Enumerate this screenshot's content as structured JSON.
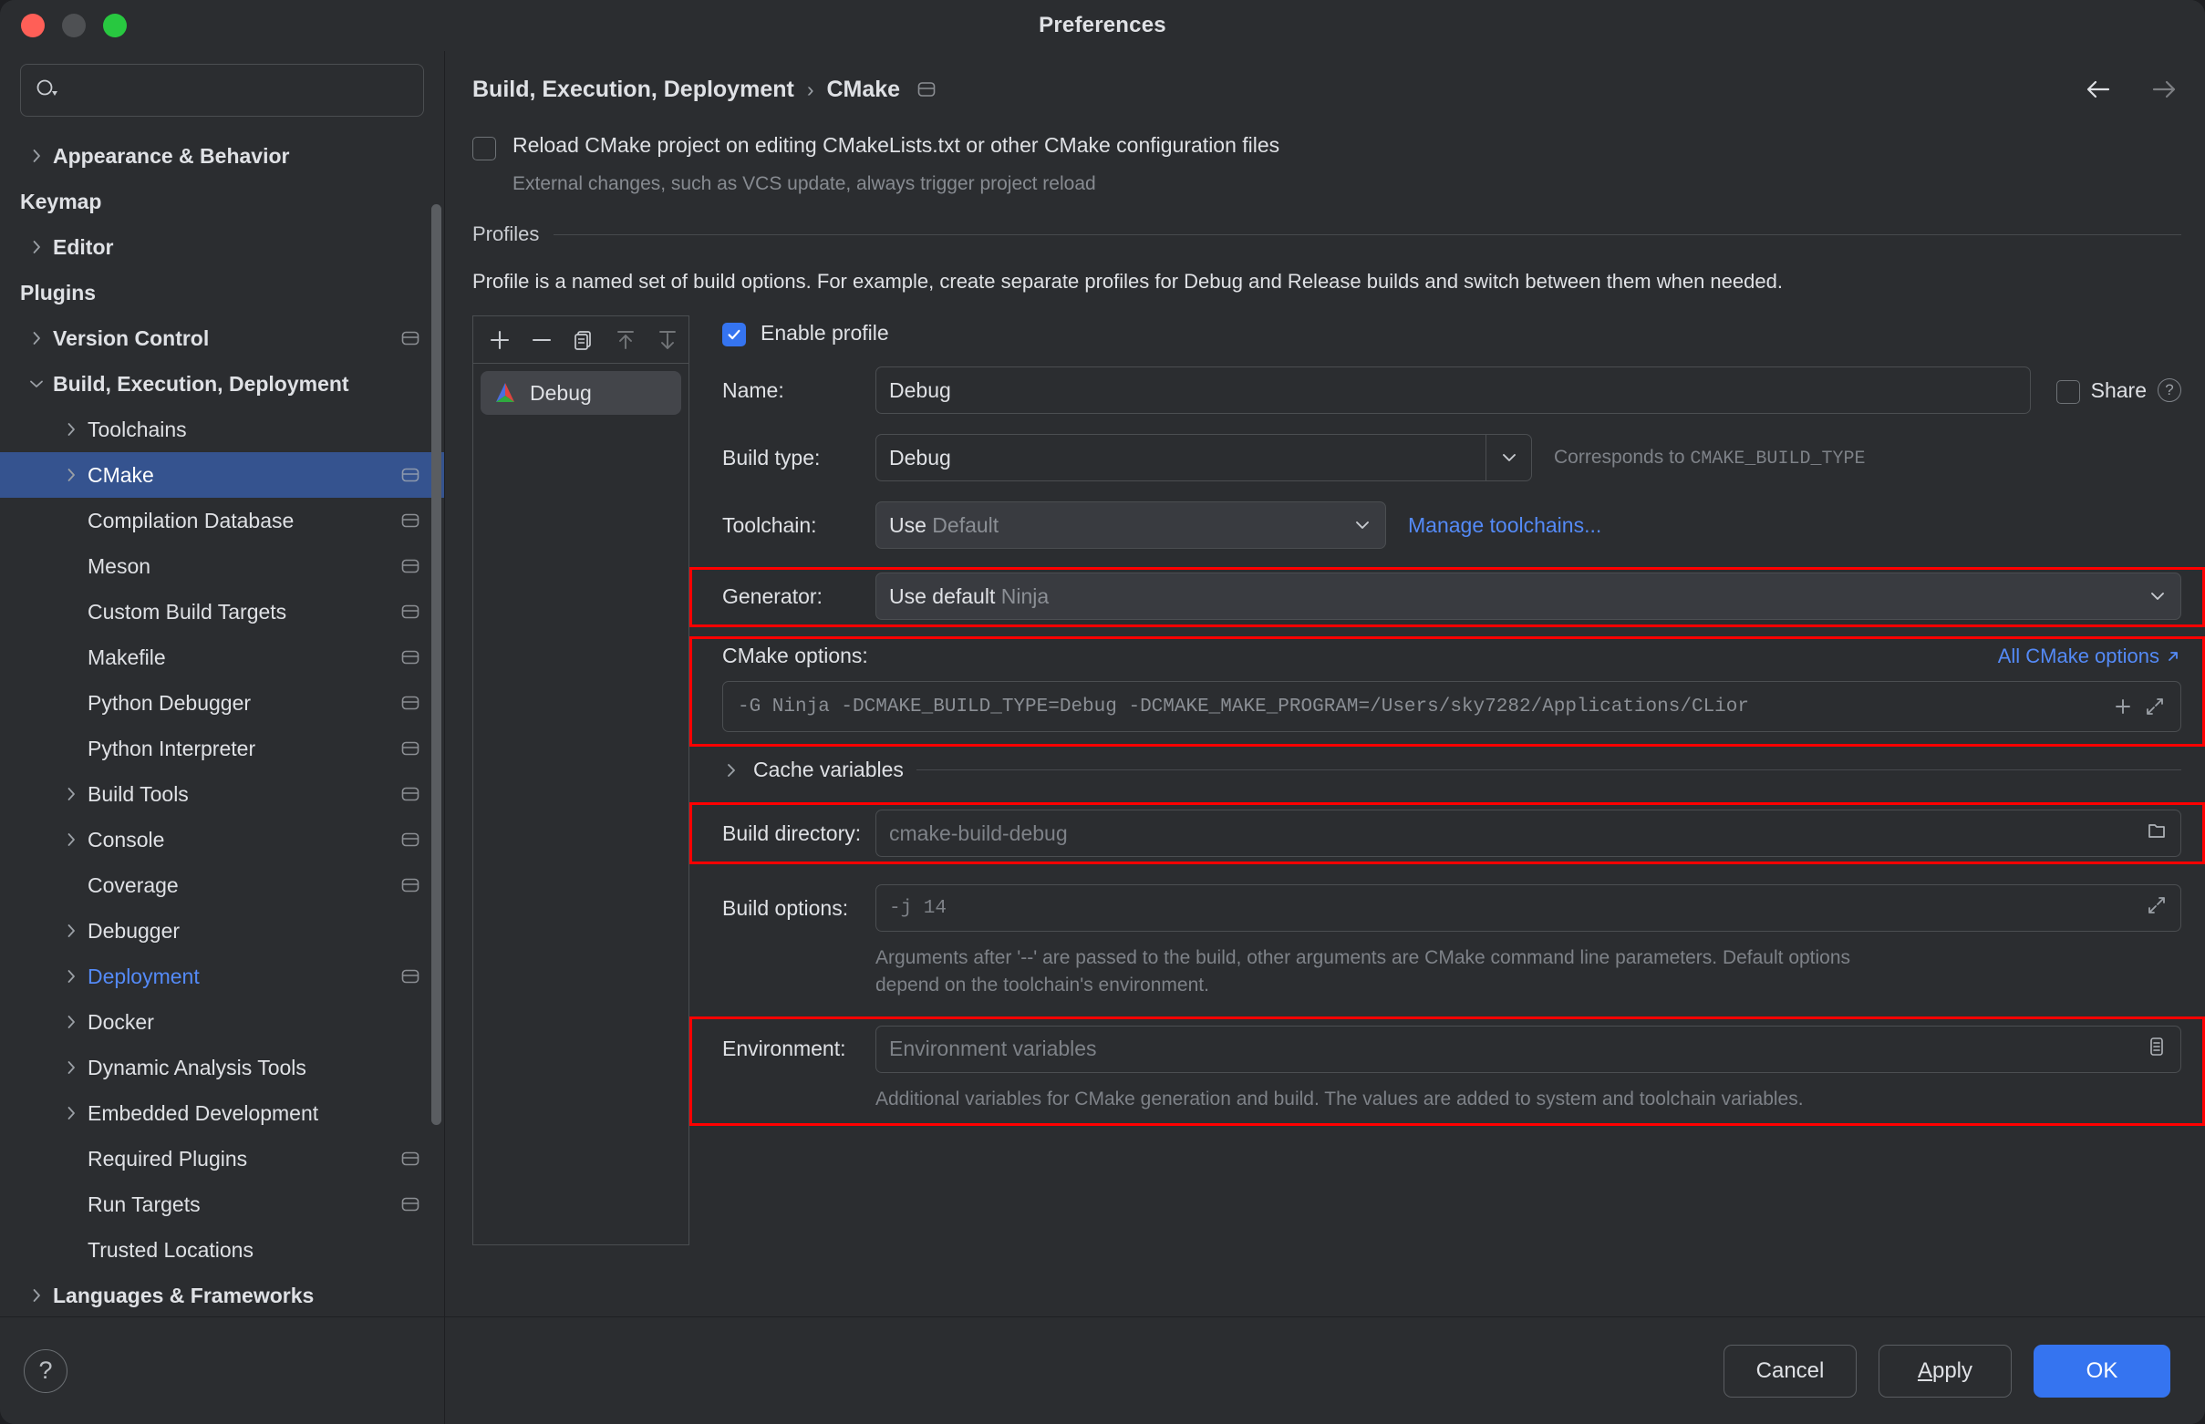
{
  "window": {
    "title": "Preferences"
  },
  "search": {
    "placeholder": "",
    "value": "",
    "icon": "search-icon"
  },
  "sidebar": {
    "items": [
      {
        "label": "Appearance & Behavior",
        "level": 0,
        "arrow": "right",
        "bold": true,
        "project_icon": false,
        "selected": false,
        "modified": false
      },
      {
        "label": "Keymap",
        "level": 0,
        "arrow": "none",
        "bold": true,
        "project_icon": false,
        "selected": false,
        "modified": false
      },
      {
        "label": "Editor",
        "level": 0,
        "arrow": "right",
        "bold": true,
        "project_icon": false,
        "selected": false,
        "modified": false
      },
      {
        "label": "Plugins",
        "level": 0,
        "arrow": "none",
        "bold": true,
        "project_icon": false,
        "selected": false,
        "modified": false
      },
      {
        "label": "Version Control",
        "level": 0,
        "arrow": "right",
        "bold": true,
        "project_icon": true,
        "selected": false,
        "modified": false
      },
      {
        "label": "Build, Execution, Deployment",
        "level": 0,
        "arrow": "down",
        "bold": true,
        "project_icon": false,
        "selected": false,
        "modified": false
      },
      {
        "label": "Toolchains",
        "level": 1,
        "arrow": "right",
        "bold": false,
        "project_icon": false,
        "selected": false,
        "modified": false
      },
      {
        "label": "CMake",
        "level": 1,
        "arrow": "right",
        "bold": false,
        "project_icon": true,
        "selected": true,
        "modified": false
      },
      {
        "label": "Compilation Database",
        "level": 1,
        "arrow": "none",
        "bold": false,
        "project_icon": true,
        "selected": false,
        "modified": false
      },
      {
        "label": "Meson",
        "level": 1,
        "arrow": "none",
        "bold": false,
        "project_icon": true,
        "selected": false,
        "modified": false
      },
      {
        "label": "Custom Build Targets",
        "level": 1,
        "arrow": "none",
        "bold": false,
        "project_icon": true,
        "selected": false,
        "modified": false
      },
      {
        "label": "Makefile",
        "level": 1,
        "arrow": "none",
        "bold": false,
        "project_icon": true,
        "selected": false,
        "modified": false
      },
      {
        "label": "Python Debugger",
        "level": 1,
        "arrow": "none",
        "bold": false,
        "project_icon": true,
        "selected": false,
        "modified": false
      },
      {
        "label": "Python Interpreter",
        "level": 1,
        "arrow": "none",
        "bold": false,
        "project_icon": true,
        "selected": false,
        "modified": false
      },
      {
        "label": "Build Tools",
        "level": 1,
        "arrow": "right",
        "bold": false,
        "project_icon": true,
        "selected": false,
        "modified": false
      },
      {
        "label": "Console",
        "level": 1,
        "arrow": "right",
        "bold": false,
        "project_icon": true,
        "selected": false,
        "modified": false
      },
      {
        "label": "Coverage",
        "level": 1,
        "arrow": "none",
        "bold": false,
        "project_icon": true,
        "selected": false,
        "modified": false
      },
      {
        "label": "Debugger",
        "level": 1,
        "arrow": "right",
        "bold": false,
        "project_icon": false,
        "selected": false,
        "modified": false
      },
      {
        "label": "Deployment",
        "level": 1,
        "arrow": "right",
        "bold": false,
        "project_icon": true,
        "selected": false,
        "modified": true
      },
      {
        "label": "Docker",
        "level": 1,
        "arrow": "right",
        "bold": false,
        "project_icon": false,
        "selected": false,
        "modified": false
      },
      {
        "label": "Dynamic Analysis Tools",
        "level": 1,
        "arrow": "right",
        "bold": false,
        "project_icon": false,
        "selected": false,
        "modified": false
      },
      {
        "label": "Embedded Development",
        "level": 1,
        "arrow": "right",
        "bold": false,
        "project_icon": false,
        "selected": false,
        "modified": false
      },
      {
        "label": "Required Plugins",
        "level": 1,
        "arrow": "none",
        "bold": false,
        "project_icon": true,
        "selected": false,
        "modified": false
      },
      {
        "label": "Run Targets",
        "level": 1,
        "arrow": "none",
        "bold": false,
        "project_icon": true,
        "selected": false,
        "modified": false
      },
      {
        "label": "Trusted Locations",
        "level": 1,
        "arrow": "none",
        "bold": false,
        "project_icon": false,
        "selected": false,
        "modified": false
      },
      {
        "label": "Languages & Frameworks",
        "level": 0,
        "arrow": "right",
        "bold": true,
        "project_icon": false,
        "selected": false,
        "modified": false
      }
    ],
    "help_label": "?"
  },
  "breadcrumb": {
    "parent": "Build, Execution, Deployment",
    "separator": "›",
    "current": "CMake",
    "icon": "project-setting-icon",
    "back_icon": "arrow-left-icon",
    "forward_icon": "arrow-right-icon"
  },
  "reload": {
    "checked": false,
    "label": "Reload CMake project on editing CMakeLists.txt or other CMake configuration files",
    "sub": "External changes, such as VCS update, always trigger project reload"
  },
  "profiles_section": {
    "title": "Profiles",
    "description": "Profile is a named set of build options. For example, create separate profiles for Debug and Release builds and switch between them when needed."
  },
  "profiles_toolbar": {
    "add": "+",
    "remove": "−",
    "copy_icon": "copy-icon",
    "up_icon": "move-up-icon",
    "down_icon": "move-down-icon"
  },
  "profiles_list": [
    {
      "name": "Debug",
      "icon": "cmake-logo-icon",
      "selected": true
    }
  ],
  "form": {
    "enable_profile": {
      "label": "Enable profile",
      "checked": true
    },
    "name": {
      "label": "Name:",
      "value": "Debug"
    },
    "share": {
      "label": "Share",
      "checked": false,
      "help": "?"
    },
    "build_type": {
      "label": "Build type:",
      "value": "Debug",
      "note_prefix": "Corresponds to ",
      "note_mono": "CMAKE_BUILD_TYPE"
    },
    "toolchain": {
      "label": "Toolchain:",
      "value": "Use",
      "value_muted": "Default",
      "manage_link": "Manage toolchains..."
    },
    "generator": {
      "label": "Generator:",
      "value": "Use default",
      "value_muted": "Ninja",
      "highlighted": true
    },
    "cmake_options": {
      "label": "CMake options:",
      "all_link": "All CMake options",
      "link_icon": "external-link-icon",
      "value": "-G Ninja -DCMAKE_BUILD_TYPE=Debug -DCMAKE_MAKE_PROGRAM=/Users/sky7282/Applications/CLior",
      "add_icon": "plus-icon",
      "expand_icon": "expand-icon",
      "highlighted": true
    },
    "cache_variables": {
      "label": "Cache variables",
      "expanded": false
    },
    "build_directory": {
      "label": "Build directory:",
      "placeholder": "cmake-build-debug",
      "browse_icon": "folder-icon",
      "highlighted": true
    },
    "build_options": {
      "label": "Build options:",
      "placeholder": "-j 14",
      "expand_icon": "expand-icon",
      "hint": "Arguments after '--' are passed to the build, other arguments are CMake command line parameters. Default options depend on the toolchain's environment."
    },
    "environment": {
      "label": "Environment:",
      "placeholder": "Environment variables",
      "edit_icon": "list-edit-icon",
      "hint": "Additional variables for CMake generation and build. The values are added to system and toolchain variables.",
      "highlighted": true
    }
  },
  "footer": {
    "cancel": "Cancel",
    "apply_mnemonic": "A",
    "apply_rest": "pply",
    "ok": "OK"
  },
  "colors": {
    "accent": "#3574f0",
    "link": "#548af7",
    "selection": "#35538f",
    "highlight": "#ff0000",
    "panel": "#2b2d30"
  }
}
